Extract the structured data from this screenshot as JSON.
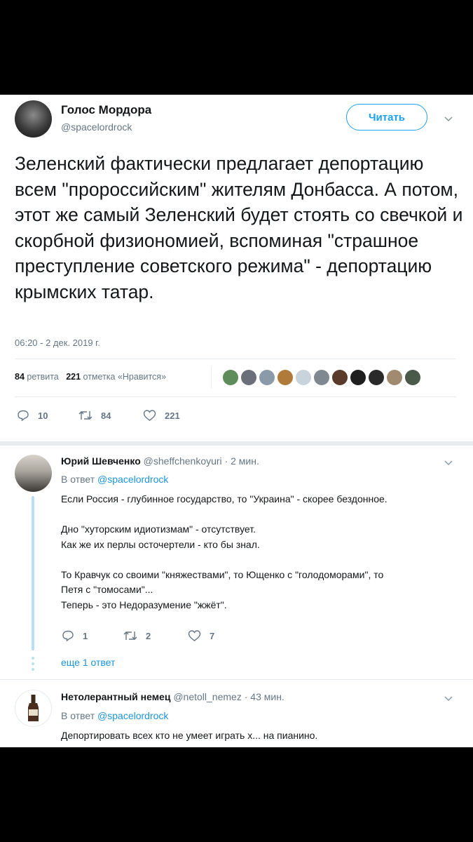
{
  "tweet": {
    "display_name": "Голос Мордора",
    "handle": "@spacelordrock",
    "follow_label": "Читать",
    "text": "Зеленский фактически предлагает депортацию всем \"пророссийским\" жителям Донбасса. А потом, этот же самый Зеленский будет стоять со свечкой и скорбной физиономией, вспоминая \"страшное преступление советского режима\" - депортацию крымских татар.",
    "timestamp": "06:20 - 2 дек. 2019 г.",
    "retweets_count": "84",
    "retweets_label": "ретвита",
    "likes_count": "221",
    "likes_label": "отметка «Нравится»",
    "actions": {
      "replies": "10",
      "retweets": "84",
      "likes": "221"
    }
  },
  "replies": [
    {
      "display_name": "Юрий Шевченко",
      "handle": "@sheffchenkoyuri",
      "time": "· 2 мин.",
      "reply_to_prefix": "В ответ",
      "reply_to_handle": "@spacelordrock",
      "lines": [
        "Если Россия - глубинное государство, то \"Украина\" - скорее бездонное.",
        "",
        "Дно \"хуторским идиотизмам\" - отсутствует.",
        "Как же их перлы осточертели - кто бы знал.",
        "",
        "То Кравчук со своими \"княжествами\", то Ющенко с \"голодоморами\", то",
        "Петя с \"томосами\"...",
        "Теперь - это Недоразумение \"жжёт\"."
      ],
      "actions": {
        "replies": "1",
        "retweets": "2",
        "likes": "7"
      },
      "more_label": "еще 1 ответ"
    },
    {
      "display_name": "Нетолерантный немец",
      "handle": "@netoll_nemez",
      "time": "· 43 мин.",
      "reply_to_prefix": "В ответ",
      "reply_to_handle": "@spacelordrock",
      "text": "Депортировать всех кто не умеет играть х... на пианино."
    }
  ],
  "colors": {
    "accent": "#1da1f2",
    "link": "#1b95e0",
    "muted": "#657786",
    "divider": "#e6ecf0",
    "thread_line": "#b8dff5"
  },
  "icons": [
    "chevron-down-icon",
    "reply-icon",
    "retweet-icon",
    "like-icon",
    "thread-dots-icon"
  ]
}
